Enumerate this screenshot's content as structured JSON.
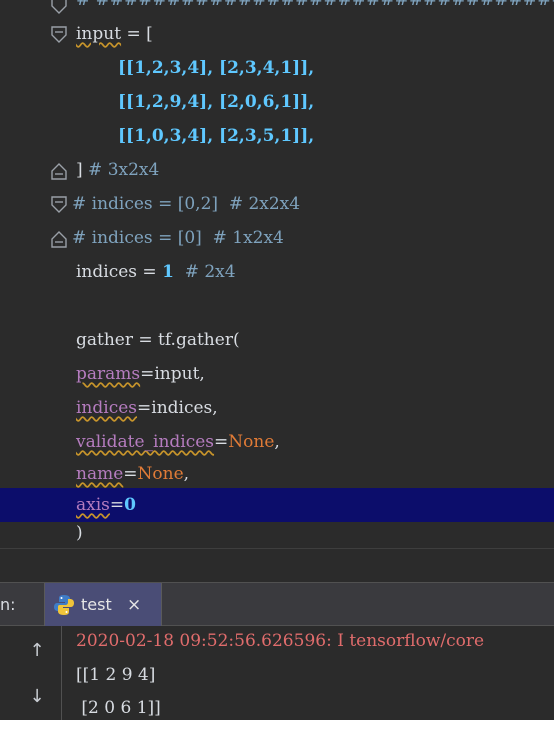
{
  "editor": {
    "lines": [
      {
        "text": "# ##############################################"
      },
      {
        "p1": "input",
        "p2": " = ["
      },
      {
        "text": "[[1,2,3,4], [2,3,4,1]],"
      },
      {
        "text": "[[1,2,9,4], [2,0,6,1]],"
      },
      {
        "text": "[[1,0,3,4], [2,3,5,1]],"
      },
      {
        "p1": "] ",
        "p2": "# 3x2x4"
      },
      {
        "text": "# indices = [0,2]  # 2x2x4"
      },
      {
        "text": "# indices = [0]  # 1x2x4"
      },
      {
        "p1": "indices = ",
        "p2": "1",
        "p3": "  # 2x4"
      },
      {
        "text": ""
      },
      {
        "text": "gather = tf.gather("
      },
      {
        "p1": "params",
        "p2": "=input,"
      },
      {
        "p1": "indices",
        "p2": "=indices,"
      },
      {
        "p1": "validate_indices",
        "p2": "=",
        "p3": "None",
        "p4": ","
      },
      {
        "p1": "name",
        "p2": "=",
        "p3": "None",
        "p4": ","
      },
      {
        "p1": "axis",
        "p2": "=",
        "p3": "0"
      },
      {
        "text": ")"
      }
    ]
  },
  "run_panel": {
    "label": "n:",
    "tab_label": "test",
    "tab_close": "×",
    "up_icon": "↑",
    "down_icon": "↓"
  },
  "console": {
    "lines": [
      "2020-02-18 09:52:56.626596: I tensorflow/core",
      "[[1 2 9 4]",
      " [2 0 6 1]]"
    ]
  },
  "colors": {
    "editor_bg": "#2b2b2b",
    "highlight": "#0c0d6b",
    "number": "#5fc8ff",
    "keyword": "#e07b37",
    "param": "#b57cbf",
    "comment": "#7fa3be",
    "error": "#e06c6c"
  }
}
